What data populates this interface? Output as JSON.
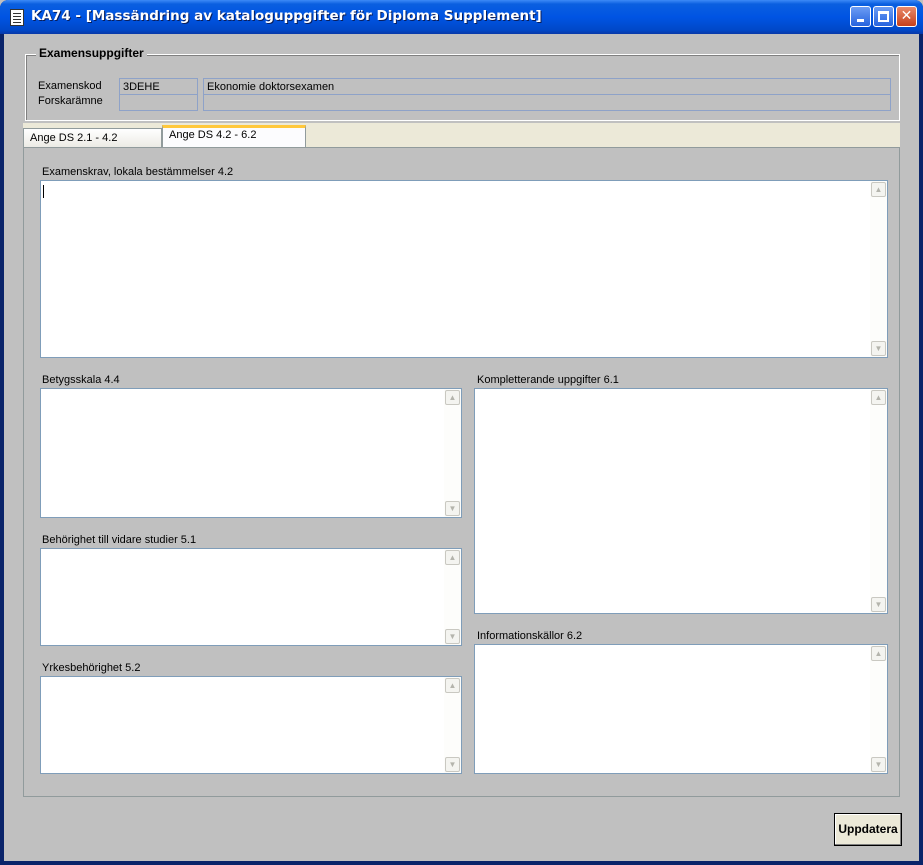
{
  "window": {
    "title": "KA74 - [Massändring av kataloguppgifter för Diploma Supplement]"
  },
  "examensuppgifter": {
    "group_title": "Examensuppgifter",
    "examenskod_label": "Examenskod",
    "examenskod_value": "3DEHE",
    "examens_name": "Ekonomie doktorsexamen",
    "forskaramne_label": "Forskarämne",
    "forskaramne_code": "",
    "forskaramne_name": ""
  },
  "tabs": [
    {
      "label": "Ange DS 2.1 - 4.2",
      "active": false
    },
    {
      "label": "Ange DS 4.2 - 6.2",
      "active": true
    }
  ],
  "fields": {
    "examenskrav": {
      "label": "Examenskrav, lokala bestämmelser  4.2",
      "value": ""
    },
    "betygsskala": {
      "label": "Betygsskala  4.4",
      "value": ""
    },
    "behorighet": {
      "label": "Behörighet till vidare studier  5.1",
      "value": ""
    },
    "yrkesbehorighet": {
      "label": "Yrkesbehörighet  5.2",
      "value": ""
    },
    "kompletterande": {
      "label": "Kompletterande uppgifter  6.1",
      "value": ""
    },
    "informationskallor": {
      "label": "Informationskällor  6.2",
      "value": ""
    }
  },
  "buttons": {
    "update_label": "Uppdatera"
  },
  "icons": {
    "app": "app-document-icon",
    "minimize": "minimize-icon",
    "maximize": "maximize-icon",
    "close": "close-icon",
    "scroll_up": "scroll-up-arrow-icon",
    "scroll_down": "scroll-down-arrow-icon"
  },
  "colors": {
    "titlebar": "#0054e3",
    "client_background": "#c0c0c0",
    "active_tab_accent": "#ffc83c",
    "field_border": "#7f9db9"
  }
}
